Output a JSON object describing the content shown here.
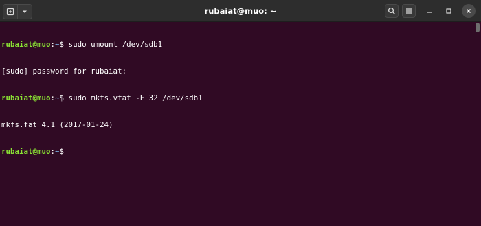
{
  "window": {
    "title": "rubaiat@muo: ~",
    "icons": {
      "new_tab": "new-tab-icon",
      "menu_dropdown": "chevron-down-icon",
      "search": "search-icon",
      "hamburger": "hamburger-menu-icon",
      "minimize": "minimize-icon",
      "maximize": "maximize-icon",
      "close": "close-icon"
    }
  },
  "colors": {
    "terminal_background": "#300a24",
    "titlebar_background": "#2d2d2d",
    "prompt_user": "#8ae234",
    "prompt_path": "#729fcf",
    "text": "#ffffff"
  },
  "terminal": {
    "lines": [
      {
        "type": "prompt",
        "user_host": "rubaiat@muo",
        "path": "~",
        "symbol": "$ ",
        "command": "sudo umount /dev/sdb1"
      },
      {
        "type": "output",
        "text": "[sudo] password for rubaiat:"
      },
      {
        "type": "prompt",
        "user_host": "rubaiat@muo",
        "path": "~",
        "symbol": "$ ",
        "command": "sudo mkfs.vfat -F 32 /dev/sdb1"
      },
      {
        "type": "output",
        "text": "mkfs.fat 4.1 (2017-01-24)"
      },
      {
        "type": "prompt",
        "user_host": "rubaiat@muo",
        "path": "~",
        "symbol": "$ ",
        "command": ""
      }
    ]
  }
}
